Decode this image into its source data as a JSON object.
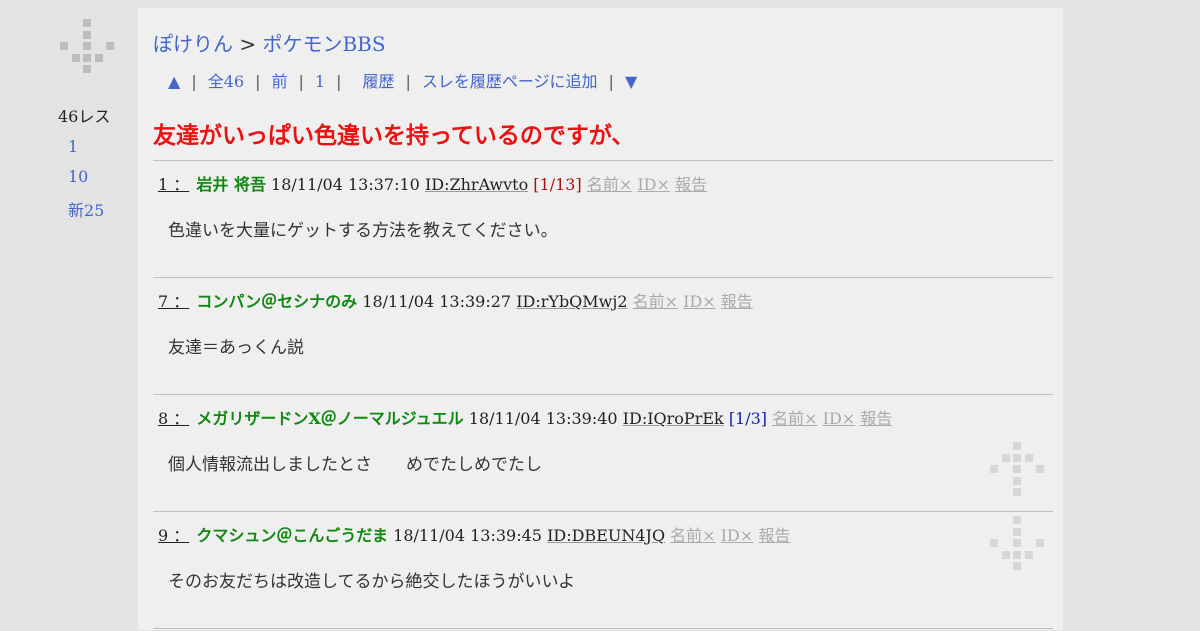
{
  "sidebar": {
    "res_count": "46レス",
    "links": [
      {
        "label": "1"
      },
      {
        "label": "10"
      },
      {
        "label": "新25"
      }
    ]
  },
  "breadcrumb": {
    "site": "ぽけりん",
    "separator": " > ",
    "board": "ポケモンBBS"
  },
  "nav": {
    "up": "▲",
    "all": "全46",
    "prev": "前",
    "first": "1",
    "history": "履歴",
    "add_history": "スレを履歴ページに追加",
    "down": "▼",
    "sep": "|"
  },
  "thread_title": "友達がいっぱい色違いを持っているのですが、",
  "posts": [
    {
      "num": "1 ：",
      "name": "岩井 将吾",
      "date": "18/11/04 13:37:10",
      "id": "ID:ZhrAwvto",
      "count": "[1/13]",
      "name_x": "名前×",
      "id_x": "ID×",
      "report": "報告",
      "body": "色違いを大量にゲットする方法を教えてください。"
    },
    {
      "num": "7 ：",
      "name": "コンパン＠セシナのみ",
      "date": "18/11/04 13:39:27",
      "id": "ID:rYbQMwj2",
      "count": "",
      "name_x": "名前×",
      "id_x": "ID×",
      "report": "報告",
      "body": "友達＝あっくん説"
    },
    {
      "num": "8 ：",
      "name": "メガリザードンX＠ノーマルジュエル",
      "date": "18/11/04 13:39:40",
      "id": "ID:IQroPrEk",
      "count": "[1/3]",
      "name_x": "名前×",
      "id_x": "ID×",
      "report": "報告",
      "body": "個人情報流出しましたとさ　　めでたしめでたし"
    },
    {
      "num": "9 ：",
      "name": "クマシュン＠こんごうだま",
      "date": "18/11/04 13:39:45",
      "id": "ID:DBEUN4JQ",
      "count": "",
      "name_x": "名前×",
      "id_x": "ID×",
      "report": "報告",
      "body": "そのお友だちは改造してるから絶交したほうがいいよ"
    }
  ],
  "colors": {
    "link": "#4466cc",
    "title": "#ee1111",
    "name": "#118811",
    "count_red": "#aa1111",
    "count_blue": "#1122aa"
  }
}
